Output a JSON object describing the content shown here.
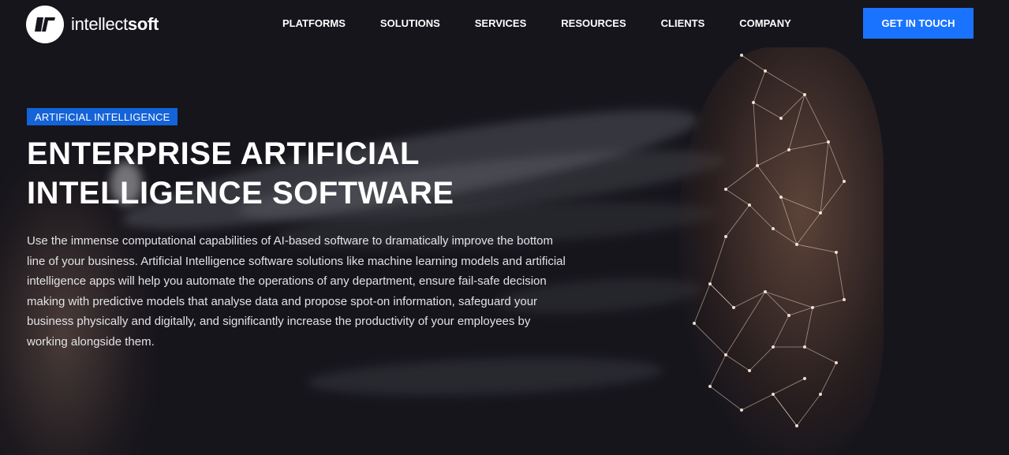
{
  "brand": {
    "name_light": "intellect",
    "name_bold": "soft",
    "logo_icon": "brand-monogram-icon"
  },
  "nav": {
    "items": [
      {
        "label": "PLATFORMS"
      },
      {
        "label": "SOLUTIONS"
      },
      {
        "label": "SERVICES"
      },
      {
        "label": "RESOURCES"
      },
      {
        "label": "CLIENTS"
      },
      {
        "label": "COMPANY"
      }
    ],
    "cta_label": "GET IN TOUCH"
  },
  "hero": {
    "badge": "ARTIFICIAL INTELLIGENCE",
    "title_line1": "ENTERPRISE ARTIFICIAL",
    "title_line2": "INTELLIGENCE SOFTWARE",
    "description": "Use the immense computational capabilities of AI-based software to dramatically improve the bottom line of your business. Artificial Intelligence software solutions like machine learning models and artificial intelligence apps will help you automate the operations of any department, ensure fail-safe decision making with predictive models that analyse data and propose spot-on information, safeguard your business physically and digitally, and significantly increase the productivity of your employees by working alongside them."
  },
  "colors": {
    "background": "#16151c",
    "accent": "#1a73ff",
    "badge": "#1463d8"
  }
}
